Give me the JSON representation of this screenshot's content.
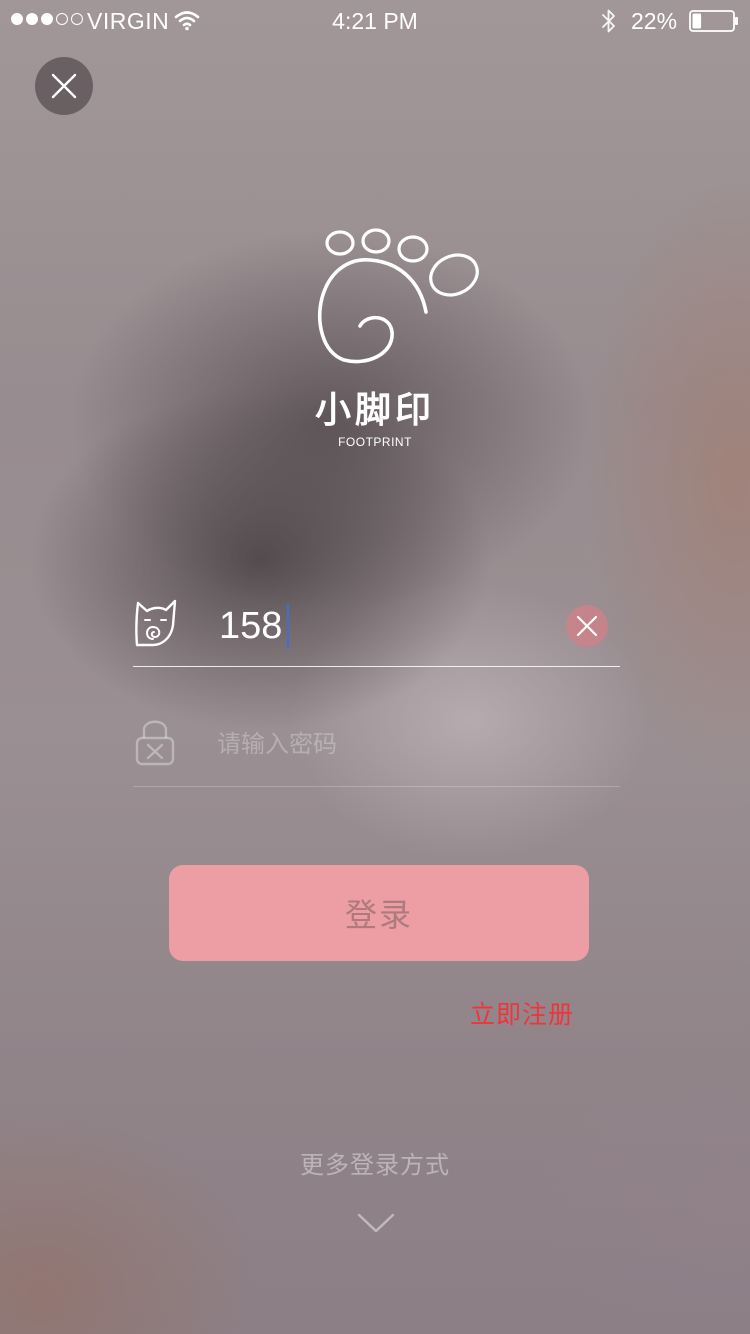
{
  "status_bar": {
    "carrier": "VIRGIN",
    "time": "4:21 PM",
    "battery_percent": "22%",
    "battery_level": 0.22,
    "signal_bars_filled": 3,
    "signal_bars_total": 5,
    "icons": [
      "wifi-icon",
      "bluetooth-icon",
      "battery-icon"
    ]
  },
  "header": {
    "close_icon": "close-icon"
  },
  "logo": {
    "name_cn": "小脚印",
    "name_en": "FOOTPRINT",
    "icon": "paw-print-logo"
  },
  "form": {
    "phone": {
      "value": "158",
      "icon": "cat-head-icon",
      "clear_icon": "clear-icon"
    },
    "password": {
      "placeholder": "请输入密码",
      "icon": "lock-icon"
    },
    "login_label": "登录",
    "register_label": "立即注册"
  },
  "footer": {
    "more_login_label": "更多登录方式",
    "expand_icon": "chevron-down-icon"
  },
  "colors": {
    "login_button": "#ec9ea4",
    "register_link": "#f0343c",
    "clear_button": "#cd828a",
    "caret": "#3d6fd8"
  }
}
